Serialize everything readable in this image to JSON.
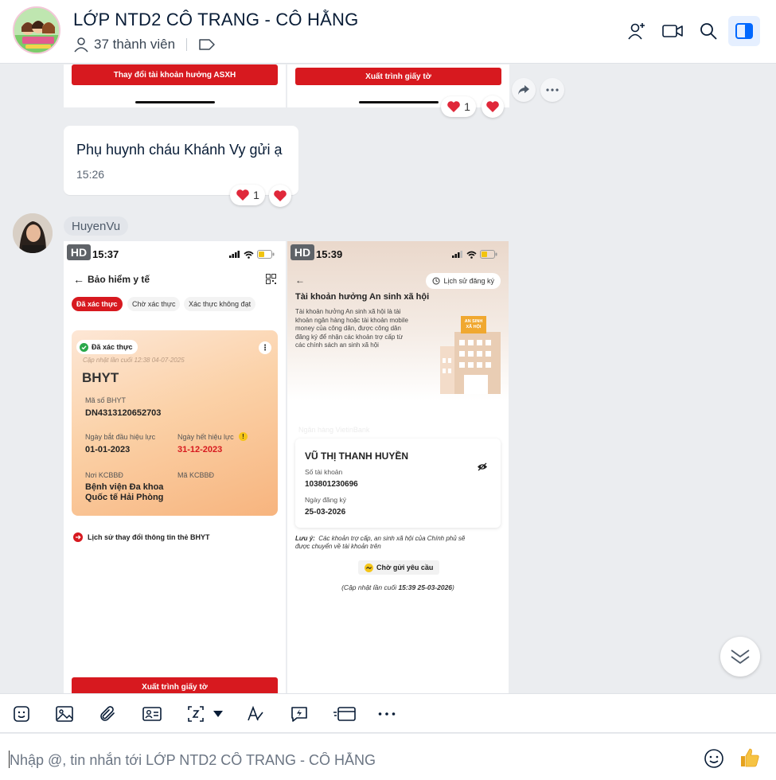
{
  "header": {
    "title": "LỚP NTD2 CÔ TRANG - CÔ HẰNG",
    "members": "37 thành viên"
  },
  "top_images": {
    "left_button": "Thay đổi tài khoản hưởng ASXH",
    "right_button": "Xuất trình giấy tờ",
    "reaction_count": "1"
  },
  "message": {
    "text": "Phụ huynh cháu Khánh Vy gửi ạ",
    "time": "15:26",
    "reaction_count": "1"
  },
  "sender": {
    "name": "HuyenVu"
  },
  "phone_left": {
    "hd": "HD",
    "time": "15:37",
    "title": "Bảo hiểm y tế",
    "tabs": [
      "Đã xác thực",
      "Chờ xác thực",
      "Xác thực không đạt"
    ],
    "status_badge": "Đã xác thực",
    "updated": "Cập nhật lần cuối 12:38 04-07-2025",
    "card_title": "BHYT",
    "code_label": "Mã số BHYT",
    "code_value": "DN4313120652703",
    "start_label": "Ngày bắt đầu hiệu lực",
    "start_value": "01-01-2023",
    "end_label": "Ngày hết hiệu lực",
    "end_value": "31-12-2023",
    "place_label": "Nơi KCBBĐ",
    "place_value_1": "Bệnh viện Đa khoa",
    "place_value_2": "Quốc tế Hải Phòng",
    "kcb_label": "Mã KCBBĐ",
    "history_link": "Lịch sử thay đổi thông tin thẻ BHYT",
    "bottom_button": "Xuất trình giấy tờ"
  },
  "phone_right": {
    "hd": "HD",
    "time": "15:39",
    "history_btn": "Lịch sử đăng ký",
    "title": "Tài khoản hưởng An sinh xã hội",
    "desc_1": "Tài khoản hưởng An sinh xã hội là tài",
    "desc_2": "khoản ngân hàng hoặc tài khoản mobile",
    "desc_3": "money của công dân, được công dân",
    "desc_4": "đăng ký để nhận các khoản trợ cấp từ",
    "desc_5": "các chính sách an sinh xã hội",
    "sign_1": "AN SINH",
    "sign_2": "XÃ HỘI",
    "bank": "Ngân hàng VietinBank",
    "holder": "VŨ THỊ THANH HUYỀN",
    "account_label": "Số tài khoản",
    "account_value": "103801230696",
    "reg_label": "Ngày đăng ký",
    "reg_value": "25-03-2026",
    "note_label": "Lưu ý:",
    "note_1": "Các khoản trợ cấp, an sinh xã hội của Chính phủ sẽ",
    "note_2": "được chuyển về tài khoản trên",
    "pending": "Chờ gửi yêu cầu",
    "updated_prefix": "(Cập nhật lần cuối ",
    "updated_value": "15:39 25-03-2026",
    "updated_suffix": ")"
  },
  "composer": {
    "placeholder": "Nhập @, tin nhắn tới LỚP NTD2 CÔ TRANG - CÔ HẰNG"
  },
  "colors": {
    "accent": "#0068ff",
    "red": "#d7191f",
    "heart": "#e0283a"
  }
}
